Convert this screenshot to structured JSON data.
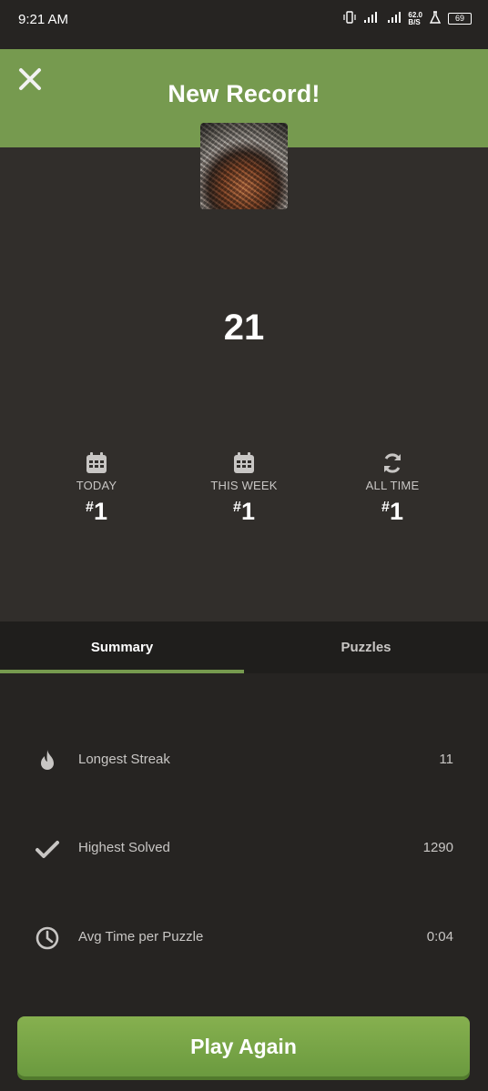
{
  "status_bar": {
    "time": "9:21 AM",
    "net_speed": "62.0",
    "net_unit": "B/S",
    "battery": "69"
  },
  "header": {
    "title": "New Record!",
    "close_icon": "close-icon"
  },
  "record": {
    "score": "21",
    "ranks": [
      {
        "label": "TODAY",
        "value": "1",
        "icon": "calendar-icon"
      },
      {
        "label": "THIS WEEK",
        "value": "1",
        "icon": "calendar-icon"
      },
      {
        "label": "ALL TIME",
        "value": "1",
        "icon": "refresh-icon"
      }
    ],
    "rank_prefix": "#"
  },
  "tabs": [
    {
      "label": "Summary",
      "active": true
    },
    {
      "label": "Puzzles",
      "active": false
    }
  ],
  "summary": {
    "stats": [
      {
        "label": "Longest Streak",
        "value": "11",
        "icon": "flame-icon"
      },
      {
        "label": "Highest Solved",
        "value": "1290",
        "icon": "check-icon"
      },
      {
        "label": "Avg Time per Puzzle",
        "value": "0:04",
        "icon": "clock-icon"
      }
    ]
  },
  "actions": {
    "play_again": "Play Again"
  },
  "colors": {
    "accent": "#769a4f",
    "panel": "#312e2b",
    "background": "#262422",
    "tabs_bg": "#1f1e1c"
  }
}
